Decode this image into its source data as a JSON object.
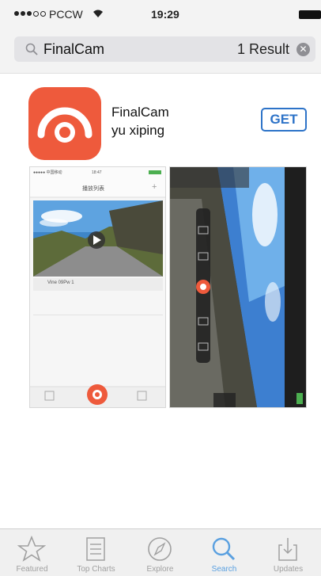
{
  "status_bar": {
    "carrier": "PCCW",
    "time": "19:29"
  },
  "search": {
    "query": "FinalCam",
    "result_count": "1 Result"
  },
  "app": {
    "name": "FinalCam",
    "developer": "yu xiping",
    "get_label": "GET",
    "brand_color": "#ee5a3c",
    "accent_color": "#2d73c8"
  },
  "screenshot1": {
    "header_title": "播放列表",
    "clip_label": "Vine 09Pw 1"
  },
  "tab_bar": {
    "tabs": [
      {
        "label": "Featured",
        "icon": "star-icon"
      },
      {
        "label": "Top Charts",
        "icon": "list-icon"
      },
      {
        "label": "Explore",
        "icon": "compass-icon"
      },
      {
        "label": "Search",
        "icon": "search-icon",
        "active": true
      },
      {
        "label": "Updates",
        "icon": "download-tray-icon"
      }
    ]
  }
}
